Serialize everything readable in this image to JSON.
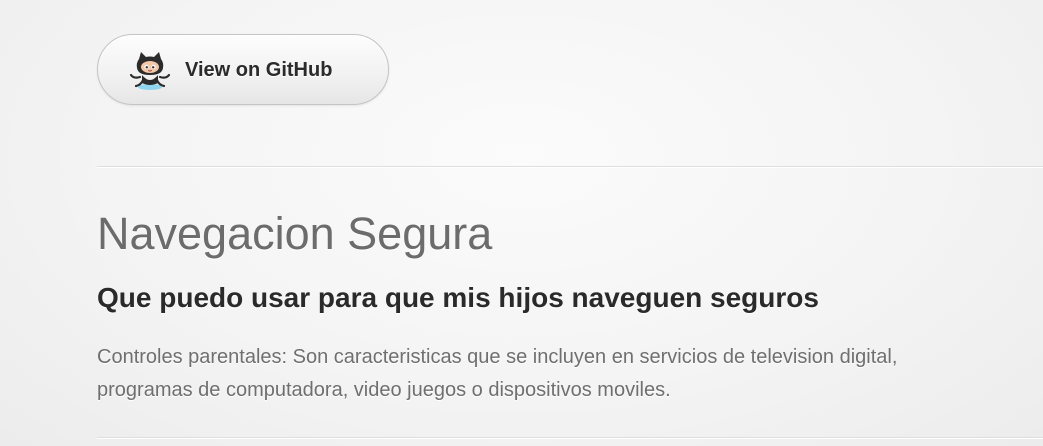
{
  "github_button": {
    "icon": "octocat-icon",
    "label": "View on GitHub"
  },
  "content": {
    "title": "Navegacion Segura",
    "subtitle": "Que puedo usar para que mis hijos naveguen seguros",
    "paragraph": "Controles parentales: Son caracteristicas que se incluyen en servicios de television digital, programas de computadora, video juegos o dispositivos moviles."
  },
  "colors": {
    "title": "#6c6c6c",
    "subtitle": "#2a2a2a",
    "paragraph": "#6f6f6f"
  }
}
